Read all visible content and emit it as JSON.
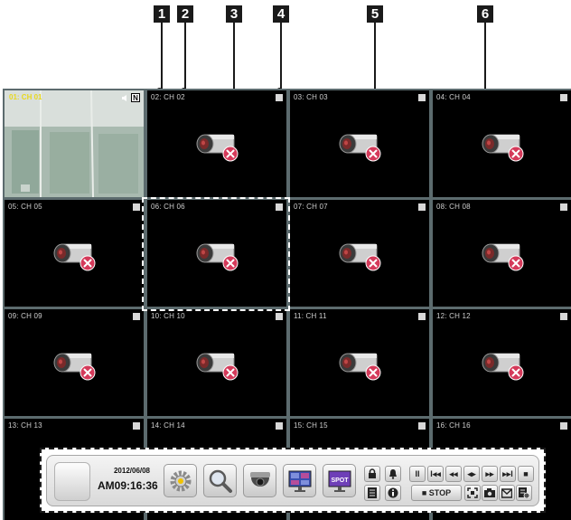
{
  "callouts": [
    "1",
    "2",
    "3",
    "4",
    "5",
    "6"
  ],
  "live_channel": {
    "label": "01: CH 01",
    "badge": "N"
  },
  "channels": [
    {
      "label": "02: CH 02"
    },
    {
      "label": "03: CH 03"
    },
    {
      "label": "04: CH 04"
    },
    {
      "label": "05: CH 05"
    },
    {
      "label": "06: CH 06"
    },
    {
      "label": "07: CH 07"
    },
    {
      "label": "08: CH 08"
    },
    {
      "label": "09: CH 09"
    },
    {
      "label": "10: CH 10"
    },
    {
      "label": "11: CH 11"
    },
    {
      "label": "12: CH 12"
    },
    {
      "label": "13: CH 13"
    },
    {
      "label": "14: CH 14"
    },
    {
      "label": "15: CH 15"
    },
    {
      "label": "16: CH 16"
    }
  ],
  "toolbar": {
    "date": "2012/06/08",
    "time": "AM09:16:36",
    "spot_label": "SPOT",
    "stop_label": "■ STOP",
    "playback": [
      "II",
      "I◂◂",
      "◂◂",
      "◂▸",
      "▸▸",
      "▸▸I",
      "■"
    ]
  },
  "colors": {
    "background": "#000000",
    "grid_line": "#5c6b6e",
    "live_label": "#e8d81e",
    "no_signal_x": "#d43a5a"
  }
}
